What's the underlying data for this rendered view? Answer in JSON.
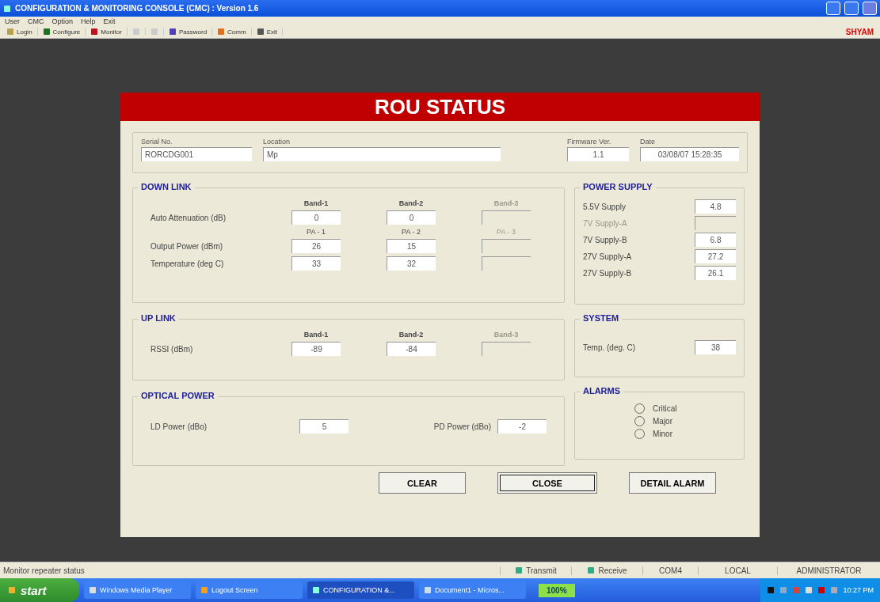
{
  "window": {
    "title": "CONFIGURATION & MONITORING CONSOLE (CMC)  :  Version 1.6"
  },
  "menu": [
    "User",
    "CMC",
    "Option",
    "Help",
    "Exit"
  ],
  "toolbar": [
    {
      "label": "Login",
      "disabled": false
    },
    {
      "label": "Configure",
      "disabled": false
    },
    {
      "label": "Monitor",
      "disabled": false
    },
    {
      "disabled": true
    },
    {
      "disabled": true
    },
    {
      "label": "Password",
      "disabled": false
    },
    {
      "label": "Comm",
      "disabled": false
    },
    {
      "label": "Exit",
      "disabled": false
    }
  ],
  "brand": "SHYAM",
  "dialog": {
    "title": "ROU STATUS",
    "info": [
      {
        "label": "Serial No.",
        "value": "RORCDG001",
        "kind": "left"
      },
      {
        "label": "Location",
        "value": "Mp",
        "kind": "left"
      },
      {
        "label": "Firmware Ver.",
        "value": "1.1",
        "kind": "center"
      },
      {
        "label": "Date",
        "value": "03/08/07 15:28:35",
        "kind": "center"
      }
    ],
    "down_link": {
      "title": "DOWN LINK",
      "bands": [
        {
          "label": "Band-1",
          "disabled": false
        },
        {
          "label": "Band-2",
          "disabled": false
        },
        {
          "label": "Band-3",
          "disabled": true
        }
      ],
      "attenuation": {
        "label": "Auto Attenuation (dB)",
        "values": [
          "0",
          "0"
        ]
      },
      "pas": [
        {
          "label": "PA - 1",
          "disabled": false
        },
        {
          "label": "PA - 2",
          "disabled": false
        },
        {
          "label": "PA - 3",
          "disabled": true
        }
      ],
      "rows": [
        {
          "label": "Output Power (dBm)",
          "values": [
            "26",
            "15"
          ]
        },
        {
          "label": "Temperature (deg C)",
          "values": [
            "33",
            "32"
          ]
        }
      ]
    },
    "up_link": {
      "title": "UP LINK",
      "bands": [
        {
          "label": "Band-1",
          "disabled": false
        },
        {
          "label": "Band-2",
          "disabled": false
        },
        {
          "label": "Band-3",
          "disabled": true
        }
      ],
      "rows": [
        {
          "label": "RSSI (dBm)",
          "values": [
            "-89",
            "-84"
          ]
        }
      ]
    },
    "optical_power": {
      "title": "OPTICAL POWER",
      "fields": [
        {
          "label": "LD Power (dBo)",
          "value": "5"
        },
        {
          "label": "PD Power (dBo)",
          "value": "-2"
        }
      ]
    },
    "power_supply": {
      "title": "POWER SUPPLY",
      "rows": [
        {
          "label": "5.5V Supply",
          "value": "4.8",
          "disabled": false
        },
        {
          "label": "7V Supply-A",
          "disabled": true
        },
        {
          "label": "7V Supply-B",
          "value": "6.8",
          "disabled": false
        },
        {
          "label": "27V Supply-A",
          "value": "27.2",
          "disabled": false
        },
        {
          "label": "27V Supply-B",
          "value": "26.1",
          "disabled": false
        }
      ]
    },
    "system": {
      "title": "SYSTEM",
      "label": "Temp. (deg. C)",
      "value": "38"
    },
    "alarms": {
      "title": "ALARMS",
      "items": [
        {
          "label": "Critical",
          "on": false
        },
        {
          "label": "Major",
          "on": false
        },
        {
          "label": "Minor",
          "on": false
        }
      ]
    },
    "buttons": [
      {
        "label": "CLEAR",
        "selected": false
      },
      {
        "label": "CLOSE",
        "selected": true
      },
      {
        "label": "DETAIL ALARM",
        "selected": false
      }
    ]
  },
  "status_bar": {
    "message": "Monitor repeater status",
    "transmit": "Transmit",
    "receive": "Receive",
    "port": "COM4",
    "mode": "LOCAL",
    "user": "ADMINISTRATOR"
  },
  "taskbar": {
    "start": "start",
    "tasks": [
      {
        "label": "Windows Media Player",
        "selected": false
      },
      {
        "label": "Logout Screen",
        "selected": false
      },
      {
        "label": "CONFIGURATION &...",
        "selected": true
      },
      {
        "label": "Document1 - Micros...",
        "selected": false
      }
    ],
    "battery": "100%",
    "clock": "10:27 PM"
  }
}
